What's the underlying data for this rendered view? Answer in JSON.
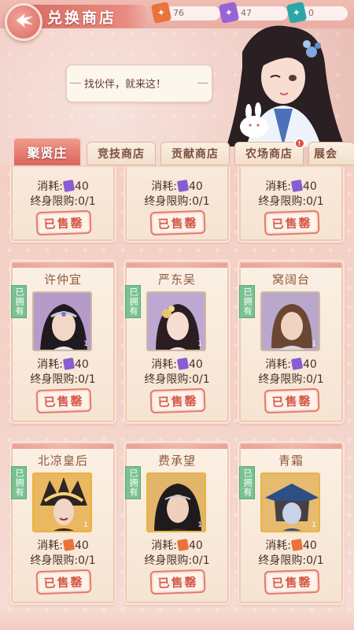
{
  "header": {
    "title": "兑换商店",
    "back_icon": "back-arrow-icon"
  },
  "currencies": [
    {
      "name": "orange-token",
      "value": "76",
      "color": "#e8743b"
    },
    {
      "name": "purple-token",
      "value": "47",
      "color": "#9a62d6"
    },
    {
      "name": "teal-token",
      "value": "0",
      "color": "#2ea6a8"
    }
  ],
  "npc": {
    "speech": "找伙伴，就来这！"
  },
  "tabs": [
    {
      "label": "聚贤庄",
      "active": true
    },
    {
      "label": "竞技商店"
    },
    {
      "label": "贡献商店"
    },
    {
      "label": "农场商店",
      "badge": true
    },
    {
      "label": "展会"
    }
  ],
  "cards": [
    {
      "name": "",
      "cost_label": "消耗:",
      "cost": "40",
      "cost_color": "#8a5cd2",
      "limit": "终身限购:0/1",
      "status": "已售罄",
      "owned": false
    },
    {
      "name": "",
      "cost_label": "消耗:",
      "cost": "40",
      "cost_color": "#8a5cd2",
      "limit": "终身限购:0/1",
      "status": "已售罄",
      "owned": false
    },
    {
      "name": "",
      "cost_label": "消耗:",
      "cost": "40",
      "cost_color": "#8a5cd2",
      "limit": "终身限购:0/1",
      "status": "已售罄",
      "owned": false
    },
    {
      "name": "许仲宜",
      "cost_label": "消耗:",
      "cost": "40",
      "cost_color": "#8a5cd2",
      "limit": "终身限购:0/1",
      "status": "已售罄",
      "owned": true,
      "owned_label": "已拥有",
      "portrait": "male-hero-silver-crown",
      "portrait_num": "1"
    },
    {
      "name": "严东吴",
      "cost_label": "消耗:",
      "cost": "40",
      "cost_color": "#8a5cd2",
      "limit": "终身限购:0/1",
      "status": "已售罄",
      "owned": true,
      "owned_label": "已拥有",
      "portrait": "female-gold-hairpin",
      "portrait_num": "1"
    },
    {
      "name": "窝阔台",
      "cost_label": "消耗:",
      "cost": "40",
      "cost_color": "#8a5cd2",
      "limit": "终身限购:0/1",
      "status": "已售罄",
      "owned": true,
      "owned_label": "已拥有",
      "portrait": "male-brown-hair-armor",
      "portrait_num": "1"
    },
    {
      "name": "北凉皇后",
      "cost_label": "消耗:",
      "cost": "40",
      "cost_color": "#e8743b",
      "limit": "终身限购:0/1",
      "status": "已售罄",
      "owned": true,
      "owned_label": "已拥有",
      "portrait": "queen-gold-headdress",
      "portrait_num": "1"
    },
    {
      "name": "费承望",
      "cost_label": "消耗:",
      "cost": "40",
      "cost_color": "#e8743b",
      "limit": "终身限购:0/1",
      "status": "已售罄",
      "owned": true,
      "owned_label": "已拥有",
      "portrait": "male-dark-hair-headband",
      "portrait_num": "1"
    },
    {
      "name": "青霜",
      "cost_label": "消耗:",
      "cost": "40",
      "cost_color": "#e8743b",
      "limit": "终身限购:0/1",
      "status": "已售罄",
      "owned": true,
      "owned_label": "已拥有",
      "portrait": "swordsman-blue-hat",
      "portrait_num": "1"
    }
  ]
}
